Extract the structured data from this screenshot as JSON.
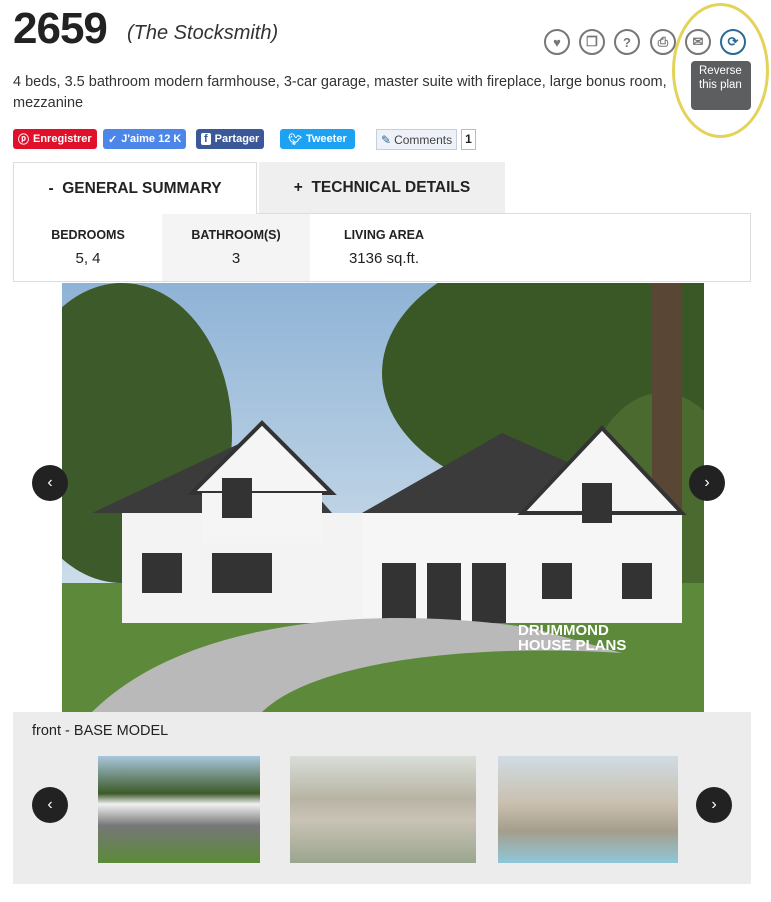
{
  "plan": {
    "number": "2659",
    "name": "(The Stocksmith)",
    "description": "4 beds, 3.5 bathroom modern farmhouse, 3-car garage, master suite with fireplace, large bonus room, mezzanine"
  },
  "actions": [
    {
      "icon": "heart-icon"
    },
    {
      "icon": "copy-icon"
    },
    {
      "icon": "help-icon",
      "glyph": "?"
    },
    {
      "icon": "print-icon"
    },
    {
      "icon": "envelope-icon"
    },
    {
      "icon": "refresh-icon"
    }
  ],
  "tooltip": {
    "text": "Reverse this plan"
  },
  "social": {
    "pinterest": "Enregistrer",
    "like": "J'aime 12 K",
    "share": "Partager",
    "tweet": "Tweeter",
    "comments": "Comments",
    "comments_count": "1"
  },
  "tabs": [
    {
      "label": "-  GENERAL SUMMARY"
    },
    {
      "label": "+  TECHNICAL DETAILS"
    }
  ],
  "summary": [
    {
      "label": "BEDROOMS",
      "value": "5, 4"
    },
    {
      "label": "BATHROOM(S)",
      "value": "3"
    },
    {
      "label": "LIVING AREA",
      "value": "3136 sq.ft."
    }
  ],
  "gallery": {
    "caption": "front - BASE MODEL",
    "watermark": "DRUMMOND HOUSE PLANS",
    "prev": "‹",
    "next": "›"
  },
  "colors": {
    "pinterest": "#e0102a",
    "like": "#4c86e8",
    "share": "#3b5998",
    "tweet": "#1da1f2",
    "accent": "#2a6a94",
    "highlight": "#e3d35a"
  }
}
